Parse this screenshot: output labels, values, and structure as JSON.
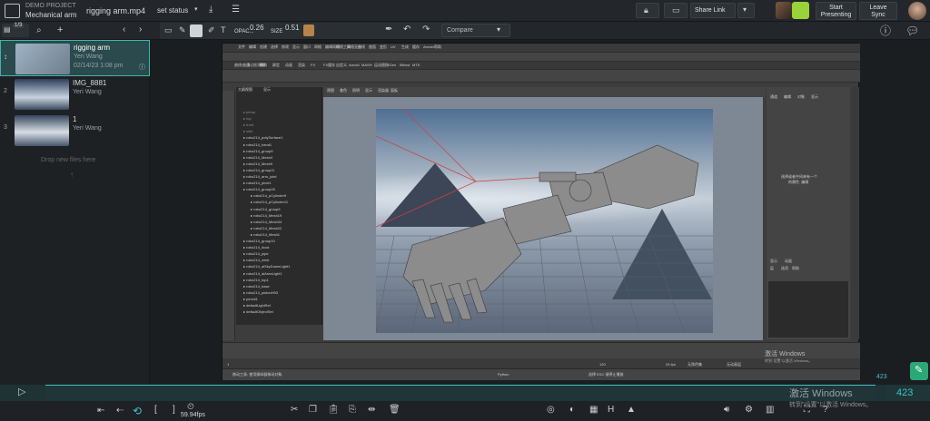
{
  "header": {
    "project_label": "DEMO PROJECT",
    "project_name": "Mechanical arm",
    "file_name": "rigging arm.mp4",
    "status_select": "set status",
    "share_link": "Share Link",
    "start_presenting_line1": "Start",
    "start_presenting_line2": "Presenting",
    "leave_sync_line1": "Leave",
    "leave_sync_line2": "Sync"
  },
  "toolbar": {
    "count_badge": "1/3",
    "opacity_label": "OPAC...",
    "opacity_value": "0.26",
    "size_label": "SIZE",
    "size_value": "0.51",
    "compare_label": "Compare",
    "colors": [
      "#e02828",
      "#ffffff",
      "#f0d020",
      "#20c020",
      "#1a1a1a",
      "#e060a0"
    ],
    "brush_color": "#b8834a"
  },
  "files": [
    {
      "index": "",
      "name": "rigging arm",
      "author": "Yeri Wang",
      "date": "02/14/23 1:08 pm"
    },
    {
      "index": "2",
      "name": "IMG_8881",
      "author": "Yeri Wang",
      "date": ""
    },
    {
      "index": "3",
      "name": "1",
      "author": "Yeri Wang",
      "date": ""
    }
  ],
  "drop_text": "Drop new files here",
  "maya": {
    "menu": [
      "文件",
      "编辑",
      "创建",
      "选择",
      "修改",
      "显示",
      "窗口",
      "网格",
      "编辑网格",
      "网格工具",
      "网格显示",
      "曲线",
      "曲面",
      "变形",
      "UV",
      "生成",
      "缓存",
      "Arnold",
      "帮助"
    ],
    "shelf_tabs": [
      "曲线/曲面",
      "多边形建模",
      "雕刻",
      "绑定",
      "动画",
      "渲染",
      "FX",
      "FX缓存",
      "自定义",
      "Arnold",
      "MASH",
      "运动图形",
      "XGen",
      "Bifrost",
      "MTK"
    ],
    "outliner_tabs": [
      "大纲视图",
      "显示"
    ],
    "outliner_items": [
      "persp",
      "top",
      "front",
      "side",
      "robo214_polySurface1",
      "robo214_hand1",
      "robo214_group9",
      "robo214_Mesh4",
      "robo214_Mesh9",
      "robo214_group11",
      "robo214_arm_joint",
      "robo214_pivot1",
      "robo214_group28",
      "robo214_pCylinder9",
      "robo214_pCylinder11",
      "robo214_group9",
      "robo214_Mesh19",
      "robo214_Mesh34",
      "robo214_Mesh22",
      "robo214_Mesh1",
      "robo214_group10",
      "robo214_dock",
      "robo214_pipe",
      "robo214_wrist",
      "robo214_aiSkyDomeLight1",
      "robo214_aiAreaLight1",
      "robo214_top1",
      "robo214_base",
      "robo214_pistonH03",
      "pencil1",
      "defaultLightSet",
      "defaultObjectSet"
    ],
    "viewport_menu": [
      "视图",
      "着色",
      "照明",
      "显示",
      "渲染器",
      "面板"
    ],
    "color_space": "ACES 1.0 SDR-video (sRGB)",
    "channel_tabs": [
      "通道",
      "编辑",
      "对象",
      "显示"
    ],
    "channel_msg_line1": "选择或者中间来有一个",
    "channel_msg_line2": "的属性. 编辑",
    "layer_tabs": [
      "显示",
      "动画"
    ],
    "layer_menu": [
      "层",
      "选项",
      "帮助"
    ],
    "python_label": "Python",
    "frame_start": "1",
    "frame_end": "120",
    "fps_label": "24 fps",
    "no_char_set": "无角色集",
    "no_anim_layer": "无动画层",
    "help_line": "移动工具: 使用操纵器移动对象.",
    "cmd_result": "选择 ESC 键停止播放.",
    "windows_watermark": "激活 Windows",
    "windows_watermark_sub": "转到\"设置\"以激活 Windows。"
  },
  "player": {
    "frame_badge": "423",
    "frame_counter": "423",
    "fps": "59.94fps",
    "windows_activate": "激活 Windows",
    "windows_activate_sub": "转到\"设置\"以激活 Windows。"
  }
}
